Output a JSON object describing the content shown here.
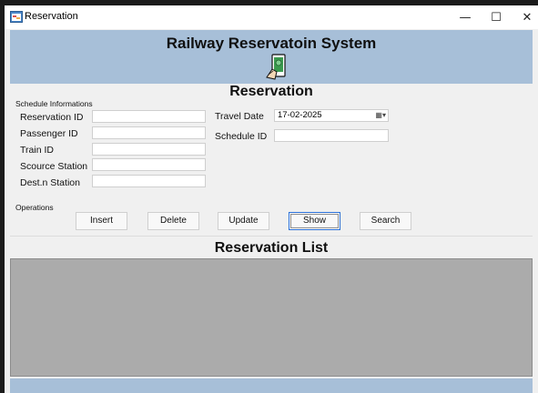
{
  "window": {
    "title": "Reservation",
    "minimize_glyph": "—",
    "maximize_glyph": "☐",
    "close_glyph": "✕"
  },
  "header": {
    "title": "Railway Reservatoin System",
    "icon": "ticket-icon"
  },
  "form": {
    "section_title": "Reservation",
    "group_label": "Schedule Informations",
    "fields": {
      "reservation_id": {
        "label": "Reservation ID",
        "value": ""
      },
      "passenger_id": {
        "label": "Passenger ID",
        "value": ""
      },
      "train_id": {
        "label": "Train ID",
        "value": ""
      },
      "source_station": {
        "label": "Scource Station",
        "value": ""
      },
      "dest_station": {
        "label": "Dest.n Station",
        "value": ""
      },
      "travel_date": {
        "label": "Travel Date",
        "value": "17-02-2025"
      },
      "schedule_id": {
        "label": "Schedule ID",
        "value": ""
      }
    }
  },
  "operations": {
    "label": "Operations",
    "insert": "Insert",
    "delete": "Delete",
    "update": "Update",
    "show": "Show",
    "search": "Search"
  },
  "list": {
    "title": "Reservation List"
  },
  "colors": {
    "header_bg": "#a7bfd8",
    "form_bg": "#f0f0f0",
    "grid_bg": "#ababab"
  }
}
